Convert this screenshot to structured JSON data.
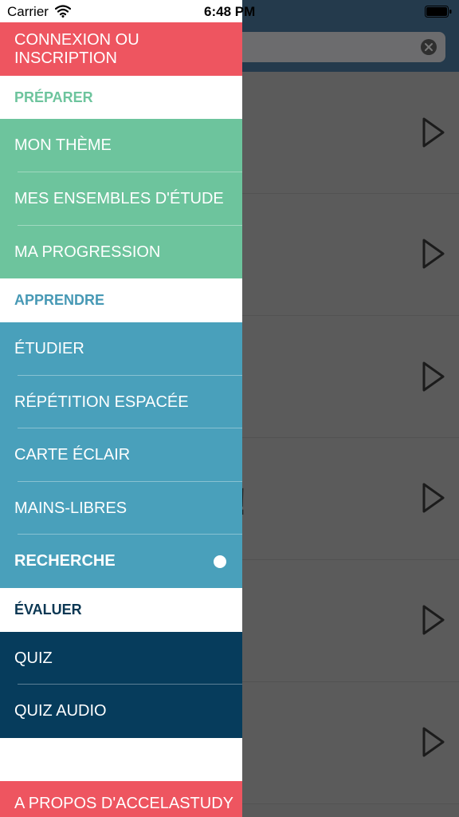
{
  "status_bar": {
    "carrier": "Carrier",
    "time": "6:48 PM"
  },
  "colors": {
    "red": "#ee5560",
    "green": "#6dc49d",
    "teal": "#49a0bb",
    "navy": "#063c5c",
    "green_header": "#6dc49d",
    "teal_header": "#4799b5",
    "navy_header": "#0b3753"
  },
  "drawer": {
    "login": "CONNEXION OU INSCRIPTION",
    "sections": {
      "prepare": {
        "header": "PRÉPARER",
        "items": [
          "MON THÈME",
          "MES ENSEMBLES D'ÉTUDE",
          "MA PROGRESSION"
        ]
      },
      "learn": {
        "header": "APPRENDRE",
        "items": [
          "ÉTUDIER",
          "RÉPÉTITION ESPACÉE",
          "CARTE ÉCLAIR",
          "MAINS-LIBRES",
          "RECHERCHE"
        ]
      },
      "evaluate": {
        "header": "ÉVALUER",
        "items": [
          "QUIZ",
          "QUIZ AUDIO"
        ]
      }
    },
    "about": "A PROPOS D'ACCELASTUDY"
  },
  "background": {
    "partial_glyph": "!"
  }
}
